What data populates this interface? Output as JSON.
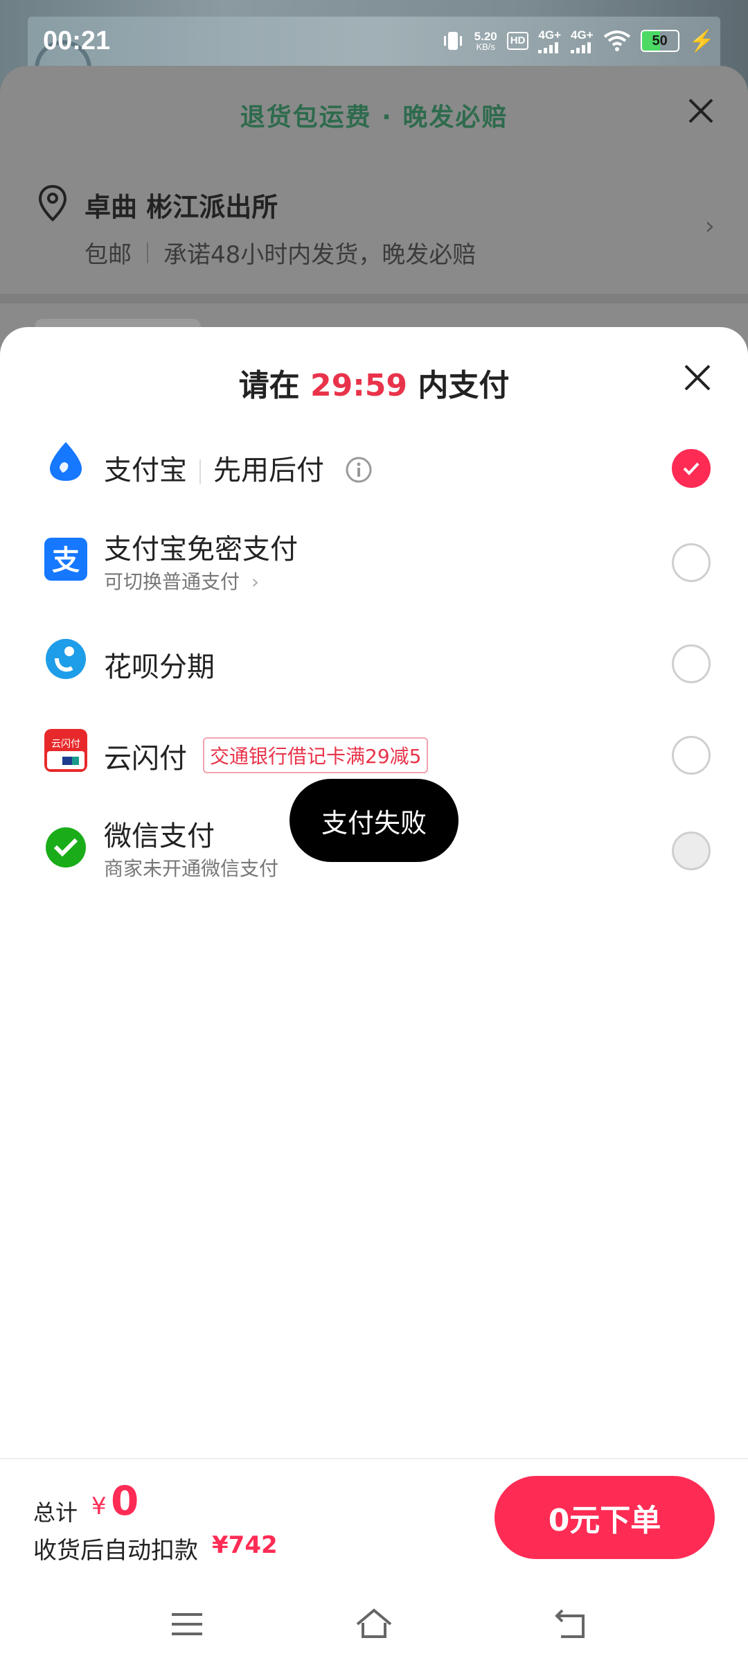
{
  "status_bar": {
    "time": "00:21",
    "net_speed_value": "5.20",
    "net_speed_unit": "KB/s",
    "hd_label": "HD",
    "signal_1": "4G+",
    "signal_2": "4G+",
    "battery": "50",
    "icons": [
      "vibrate-icon",
      "wifi-icon",
      "charging-icon"
    ]
  },
  "background_sheet": {
    "banner": "退货包运费 · 晚发必赔",
    "location": "卓曲 彬江派出所",
    "shipping": "包邮",
    "promise": "承诺48小时内发货，晚发必赔"
  },
  "payment_sheet": {
    "title_prefix": "请在",
    "countdown": "29:59",
    "title_suffix": "内支付",
    "methods": [
      {
        "label": "支付宝",
        "sub_inline": "先用后付",
        "icon": "alipay-drop-icon",
        "state": "checked"
      },
      {
        "label": "支付宝免密支付",
        "sublabel": "可切换普通支付",
        "icon": "alipay-icon",
        "state": "unchecked"
      },
      {
        "label": "花呗分期",
        "icon": "huabei-icon",
        "state": "unchecked"
      },
      {
        "label": "云闪付",
        "promo": "交通银行借记卡满29减5",
        "icon": "unionpay-icon",
        "state": "unchecked"
      },
      {
        "label": "微信支付",
        "sublabel": "商家未开通微信支付",
        "icon": "wechat-pay-icon",
        "state": "disabled"
      }
    ]
  },
  "toast": "支付失败",
  "footer": {
    "total_label": "总计",
    "currency": "¥",
    "total_amount": "0",
    "deduct_label": "收货后自动扣款",
    "deduct_amount": "¥742",
    "order_button": "0元下单"
  },
  "colors": {
    "accent": "#fe2c55",
    "countdown": "#e8334a",
    "banner_green": "#2e6b4d"
  }
}
